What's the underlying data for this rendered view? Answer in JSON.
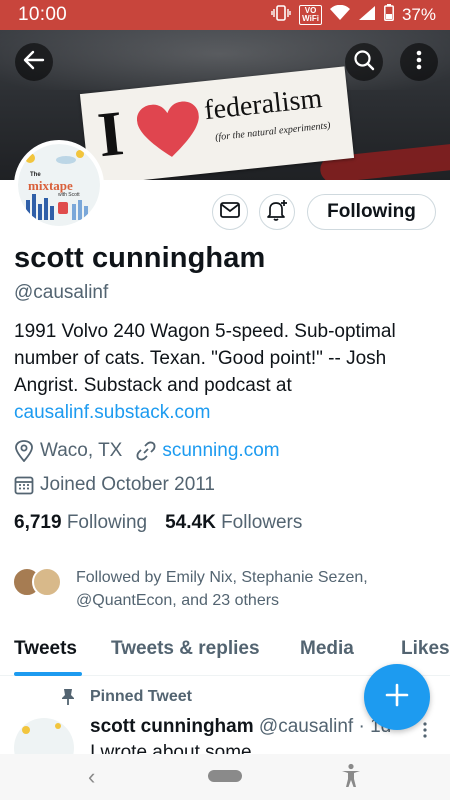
{
  "status_bar": {
    "time": "10:00",
    "volte_top": "VO",
    "volte_bottom": "WiFi",
    "battery": "37%"
  },
  "banner": {
    "sticker_letter": "I",
    "sticker_word": "federalism",
    "sticker_subtitle": "(for the natural experiments)"
  },
  "avatar": {
    "title_prefix": "The",
    "title": "mixtape",
    "subtitle": "with Scott"
  },
  "actions": {
    "following_label": "Following"
  },
  "profile": {
    "name": "scott cunningham",
    "handle": "@causalinf",
    "bio": "1991 Volvo 240 Wagon 5-speed. Sub-optimal number of cats. Texan. \"Good point!\" -- Josh Angrist. Substack and podcast at",
    "bio_link": "causalinf.substack.com",
    "location": "Waco, TX",
    "website": "scunning.com",
    "joined": "Joined October 2011",
    "following_count": "6,719",
    "following_label": "Following",
    "followers_count": "54.4K",
    "followers_label": "Followers",
    "followed_by": "Followed by Emily Nix, Stephanie Sezen, @QuantEcon, and 23 others"
  },
  "tabs": [
    {
      "label": "Tweets"
    },
    {
      "label": "Tweets & replies"
    },
    {
      "label": "Media"
    },
    {
      "label": "Likes"
    }
  ],
  "tweet": {
    "pinned_label": "Pinned Tweet",
    "name": "scott cunningham",
    "handle_time": "@causalinf · 1d",
    "text": "I wrote about some..."
  },
  "colors": {
    "accent": "#1d9bf0",
    "status_bar": "#c8453c",
    "text_primary": "#0f1419",
    "text_secondary": "#536471"
  }
}
